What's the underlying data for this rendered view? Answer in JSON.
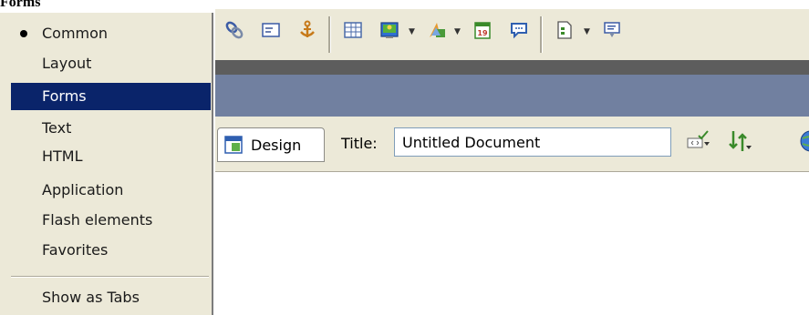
{
  "top_label": "Forms",
  "menu": {
    "items": [
      {
        "label": "Common",
        "checked": true
      },
      {
        "label": "Layout"
      },
      {
        "label": "Forms",
        "selected": true
      },
      {
        "label": "Text"
      },
      {
        "label": "HTML"
      },
      {
        "label": "Application"
      },
      {
        "label": "Flash elements"
      },
      {
        "label": "Favorites"
      }
    ],
    "show_as_tabs": "Show as Tabs"
  },
  "toolbar": {
    "icons": [
      "hyperlink-icon",
      "email-link-icon",
      "named-anchor-icon",
      "table-icon",
      "image-icon",
      "media-icon",
      "date-icon",
      "comment-icon",
      "templates-icon",
      "tag-chooser-icon"
    ]
  },
  "doc_toolbar": {
    "design_label": "Design",
    "title_label": "Title:",
    "title_value": "Untitled Document"
  },
  "colors": {
    "menu_bg": "#ece9d8",
    "menu_selected": "#0a246a",
    "slate_strip": "#7180a0",
    "dark_strip": "#5d5d5d"
  }
}
